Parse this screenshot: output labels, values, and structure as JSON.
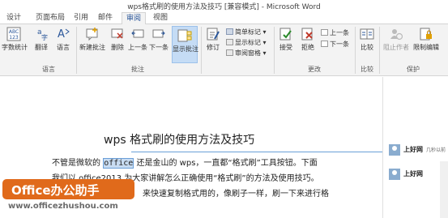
{
  "window": {
    "title": "wps格式刷的使用方法及技巧 [兼容模式] - Microsoft Word"
  },
  "tabs": [
    {
      "label": "设计",
      "active": false
    },
    {
      "label": "页面布局",
      "active": false
    },
    {
      "label": "引用",
      "active": false
    },
    {
      "label": "邮件",
      "active": false
    },
    {
      "label": "审阅",
      "active": true
    },
    {
      "label": "视图",
      "active": false
    }
  ],
  "ribbon": {
    "groups": {
      "language": "语言",
      "comments": "批注",
      "changes": "更改",
      "compare": "比较",
      "protect": "保护"
    },
    "buttons": {
      "word_count": "字数统计",
      "translate": "翻译",
      "language": "语言",
      "new_comment": "新建批注",
      "delete": "删除",
      "previous": "上一条",
      "next": "下一条",
      "show_comments": "显示批注",
      "track_changes": "修订",
      "accept": "接受",
      "reject": "拒绝",
      "compare": "比较",
      "block_authors": "阻止作者",
      "restrict_editing": "限制编辑"
    },
    "small": {
      "simple_markup": "简单标记",
      "show_markup": "显示标记",
      "reviewing_pane": "审阅窗格",
      "prev_change": "上一条",
      "next_change": "下一条"
    },
    "icons": {
      "word_count": "abc-123-icon",
      "translate": "translate-icon",
      "language": "language-icon",
      "new_comment": "new-comment-icon",
      "delete": "delete-comment-icon",
      "previous": "previous-comment-icon",
      "next": "next-comment-icon",
      "show_comments": "show-comments-icon",
      "track_changes": "track-changes-icon",
      "accept": "accept-icon",
      "reject": "reject-icon",
      "compare": "compare-icon",
      "block_authors": "block-authors-icon",
      "restrict_editing": "restrict-editing-icon"
    },
    "accent": "#2b579a"
  },
  "document": {
    "title": "wps 格式刷的使用方法及技巧",
    "para1_before": "不管是微软的 ",
    "para1_highlight": "office",
    "para1_after": " 还是金山的 wps，一直都“格式刷”工具按钮。下面",
    "para2": "我们以 office2013 为大家讲解怎么正确使用“格式刷”的方法及使用技巧。",
    "para3": "来快速复制格式用的，像刷子一样，刷一下来进行格"
  },
  "comments": [
    {
      "author": "上好网",
      "time": "几秒以前"
    },
    {
      "author": "上好网",
      "time": ""
    }
  ],
  "watermark": {
    "brand": "Office办公助手",
    "url": "www.officezhushou.com",
    "color": "#e06a1b"
  }
}
